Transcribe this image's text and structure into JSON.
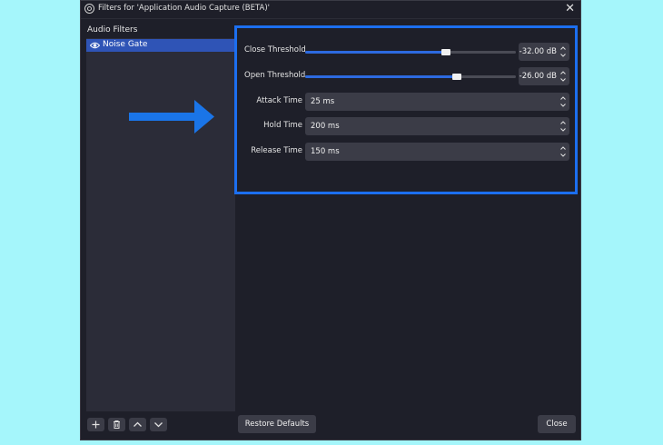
{
  "window": {
    "title": "Filters for 'Application Audio Capture (BETA)'",
    "close_glyph": "✕"
  },
  "left_panel": {
    "label": "Audio Filters",
    "filters": [
      {
        "label": "Noise Gate",
        "icon": "eye-icon",
        "selected": true
      }
    ],
    "buttons": [
      {
        "name": "add-filter-button",
        "icon": "plus-icon"
      },
      {
        "name": "remove-filter-button",
        "icon": "trash-icon"
      },
      {
        "name": "move-up-button",
        "icon": "chevron-up-icon"
      },
      {
        "name": "move-down-button",
        "icon": "chevron-down-icon"
      }
    ]
  },
  "settings": {
    "close_threshold": {
      "label": "Close Threshold",
      "value": "-32.00 dB",
      "slider_fraction": 0.67
    },
    "open_threshold": {
      "label": "Open Threshold",
      "value": "-26.00 dB",
      "slider_fraction": 0.72
    },
    "attack_time": {
      "label": "Attack Time",
      "value": "25 ms"
    },
    "hold_time": {
      "label": "Hold Time",
      "value": "200 ms"
    },
    "release_time": {
      "label": "Release Time",
      "value": "150 ms"
    }
  },
  "footer": {
    "restore_defaults": "Restore Defaults",
    "close": "Close"
  },
  "colors": {
    "highlight_border": "#1c6ff0",
    "arrow": "#1a75e8",
    "selected_item": "#2f54b6",
    "slider_fill": "#2d6ae0",
    "window_bg": "#1e1f29"
  }
}
